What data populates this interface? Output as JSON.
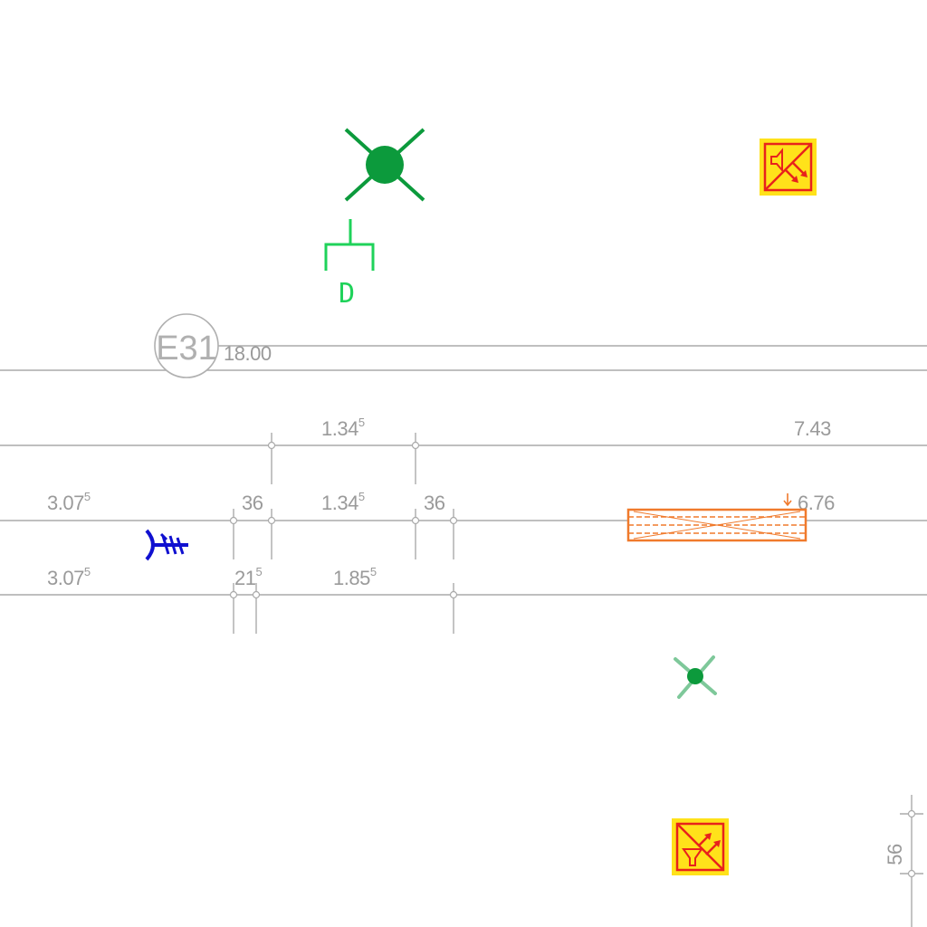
{
  "grid_ref": {
    "label": "E31",
    "elevation": "18.00"
  },
  "dimensions": {
    "top_span": {
      "base": "1.34",
      "sup": "5"
    },
    "top_right": "7.43",
    "mid_left": {
      "base": "3.07",
      "sup": "5"
    },
    "mid_gap_left": "36",
    "mid_span": {
      "base": "1.34",
      "sup": "5"
    },
    "mid_gap_right": "36",
    "mid_right": "6.76",
    "low_left": {
      "base": "3.07",
      "sup": "5"
    },
    "low_gap": {
      "base": "21",
      "sup": "5"
    },
    "low_span": {
      "base": "1.85",
      "sup": "5"
    },
    "side_vertical": "56"
  },
  "symbols": {
    "detector_label": "D",
    "colors": {
      "green": "#0c9a3c",
      "light_green": "#1fd25a",
      "orange": "#f07a2c",
      "yellow": "#ffe21a",
      "red": "#e8221c",
      "blue": "#1010d0"
    }
  }
}
